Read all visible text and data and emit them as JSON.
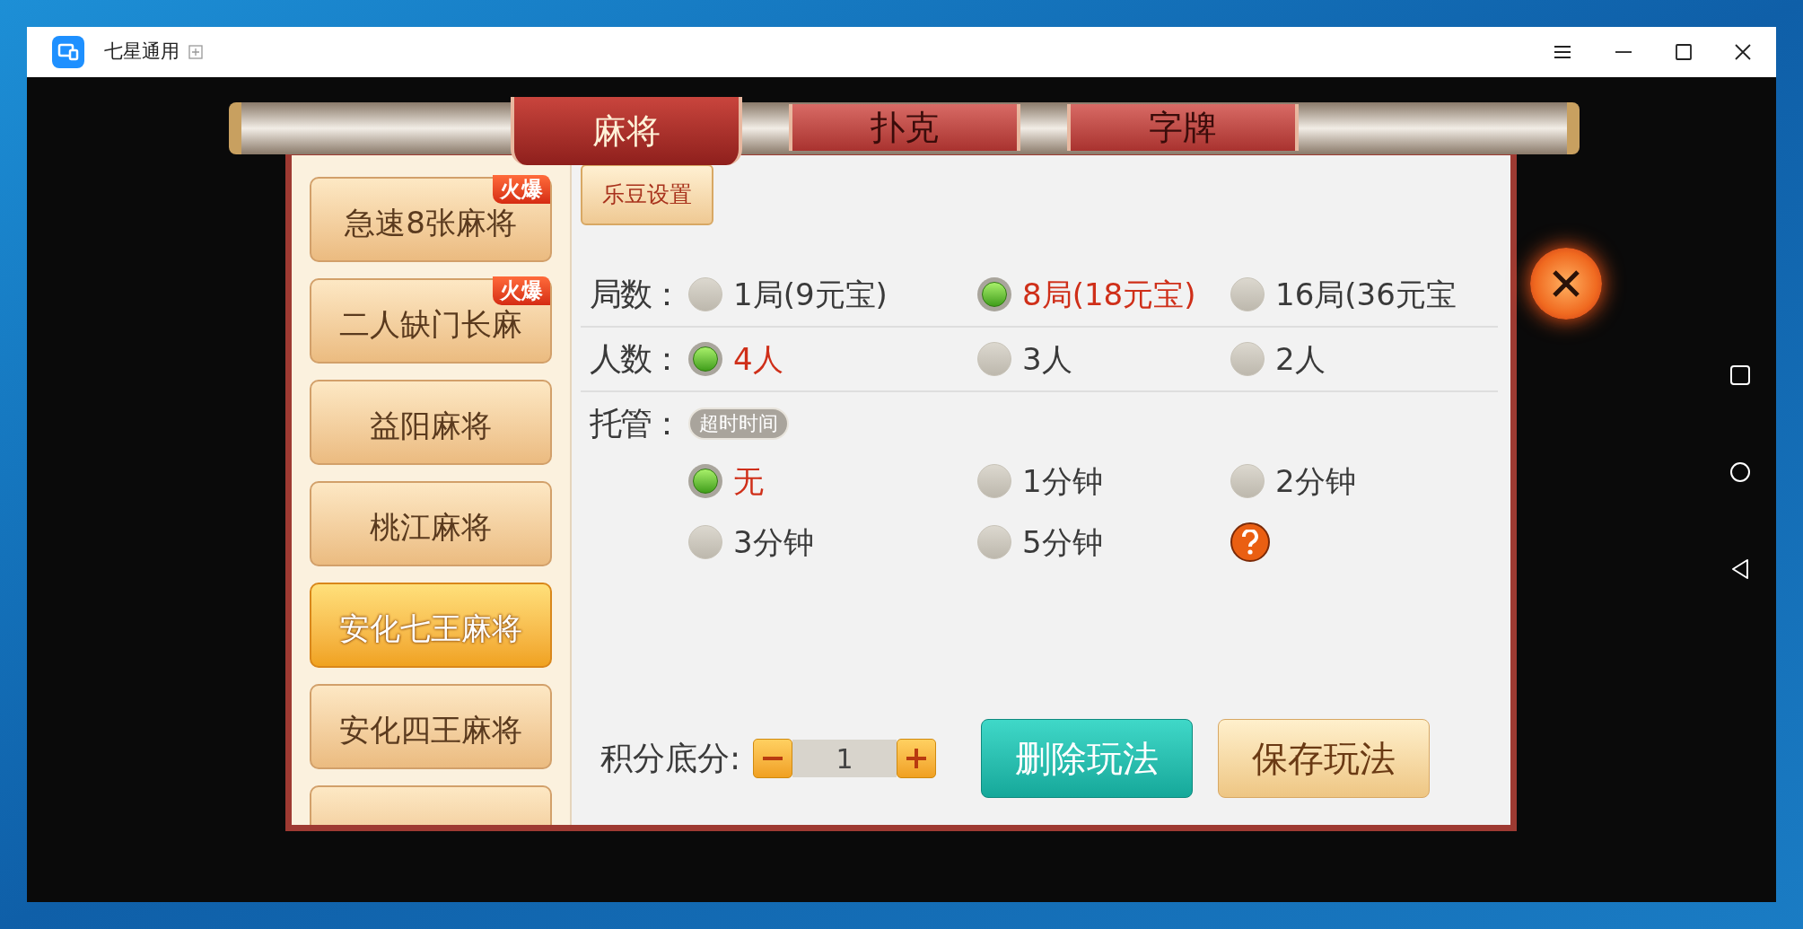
{
  "window": {
    "title": "七星通用"
  },
  "tabs": [
    {
      "label": "麻将",
      "selected": true
    },
    {
      "label": "扑克",
      "selected": false
    },
    {
      "label": "字牌",
      "selected": false
    }
  ],
  "game_list": [
    {
      "label": "急速8张麻将",
      "badge": "火爆",
      "selected": false
    },
    {
      "label": "二人缺门长麻",
      "badge": "火爆",
      "selected": false
    },
    {
      "label": "益阳麻将",
      "selected": false
    },
    {
      "label": "桃江麻将",
      "selected": false
    },
    {
      "label": "安化七王麻将",
      "selected": true
    },
    {
      "label": "安化四王麻将",
      "selected": false
    }
  ],
  "bean_settings_button": "乐豆设置",
  "option_groups": [
    {
      "label": "局数：",
      "options": [
        {
          "label": "1局(9元宝)",
          "selected": false
        },
        {
          "label": "8局(18元宝)",
          "selected": true
        },
        {
          "label": "16局(36元宝",
          "selected": false
        }
      ]
    },
    {
      "label": "人数：",
      "options": [
        {
          "label": "4人",
          "selected": true
        },
        {
          "label": "3人",
          "selected": false
        },
        {
          "label": "2人",
          "selected": false
        }
      ]
    },
    {
      "label": "托管：",
      "tag": "超时时间",
      "help": true,
      "options": [
        {
          "label": "无",
          "selected": true
        },
        {
          "label": "1分钟",
          "selected": false
        },
        {
          "label": "2分钟",
          "selected": false
        },
        {
          "label": "3分钟",
          "selected": false
        },
        {
          "label": "5分钟",
          "selected": false
        }
      ]
    }
  ],
  "score": {
    "label": "积分底分:",
    "value": "1"
  },
  "delete_button": "删除玩法",
  "save_button": "保存玩法"
}
